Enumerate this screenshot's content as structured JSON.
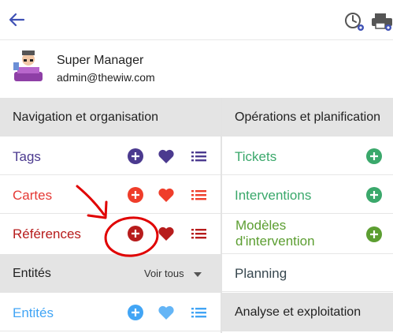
{
  "header": {
    "back_icon": "arrow-left-icon",
    "history_icon": "clock-gear-icon",
    "print_icon": "printer-gear-icon",
    "accent": "#3f51b5"
  },
  "user": {
    "name": "Super Manager",
    "email": "admin@thewiw.com"
  },
  "left": {
    "section1": {
      "title": "Navigation et organisation"
    },
    "rows": [
      {
        "label": "Tags",
        "color": "#4b3a8f"
      },
      {
        "label": "Cartes",
        "color": "#e53935"
      },
      {
        "label": "Références",
        "color": "#b71c1c"
      }
    ],
    "section2": {
      "title": "Entités",
      "voir_tous": "Voir tous"
    },
    "entites": {
      "label": "Entités",
      "color": "#42a5f5"
    }
  },
  "right": {
    "section1": {
      "title": "Opérations et planification"
    },
    "rows": [
      {
        "label": "Tickets",
        "color": "#3aa86b"
      },
      {
        "label": "Interventions",
        "color": "#3aa86b"
      },
      {
        "label_line1": "Modèles",
        "label_line2": "d'intervention",
        "color": "#5c9e31"
      },
      {
        "label": "Planning",
        "color": "#37474f"
      }
    ],
    "section2": {
      "title": "Analyse et exploitation"
    }
  }
}
